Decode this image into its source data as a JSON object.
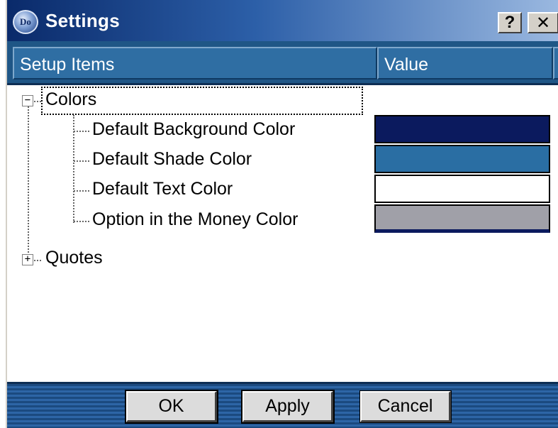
{
  "window": {
    "title": "Settings",
    "icon_text": "Do",
    "help_label": "?",
    "close_label": "✕"
  },
  "columns": {
    "setup_items": "Setup Items",
    "value": "Value"
  },
  "tree": {
    "colors": {
      "label": "Colors",
      "expander": "−",
      "items": [
        {
          "label": "Default Background Color",
          "color": "#0b1a5e"
        },
        {
          "label": "Default Shade Color",
          "color": "#2a6ea3"
        },
        {
          "label": "Default Text Color",
          "color": "#ffffff"
        },
        {
          "label": "Option in the Money Color",
          "color": "#a0a0a8"
        }
      ]
    },
    "quotes": {
      "label": "Quotes",
      "expander": "+"
    }
  },
  "buttons": {
    "ok": "OK",
    "apply": "Apply",
    "cancel": "Cancel"
  }
}
